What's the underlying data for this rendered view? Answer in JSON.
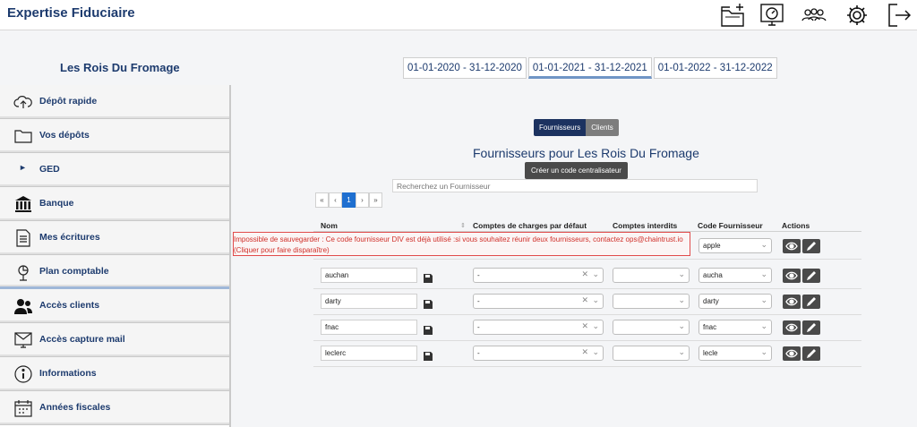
{
  "app": {
    "title": "Expertise Fiduciaire"
  },
  "topbar": {
    "icons": [
      "folder-plus-icon",
      "dashboard-icon",
      "users-icon",
      "gear-icon",
      "logout-icon"
    ]
  },
  "client": {
    "name": "Les Rois Du Fromage"
  },
  "years": [
    {
      "label": "01-01-2020 - 31-12-2020"
    },
    {
      "label": "01-01-2021 - 31-12-2021",
      "active": true
    },
    {
      "label": "01-01-2022 - 31-12-2022"
    }
  ],
  "sidebar": {
    "items": [
      {
        "label": "Dépôt rapide",
        "icon": "cloud-upload-icon"
      },
      {
        "label": "Vos dépôts",
        "icon": "folder-icon"
      },
      {
        "label": "GED",
        "icon": "caret-right-icon"
      },
      {
        "label": "Banque",
        "icon": "bank-icon"
      },
      {
        "label": "Mes écritures",
        "icon": "document-icon"
      },
      {
        "label": "Plan comptable",
        "icon": "chart-tree-icon"
      },
      {
        "label": "Accès clients",
        "icon": "users-icon"
      },
      {
        "label": "Accès capture mail",
        "icon": "mail-capture-icon"
      },
      {
        "label": "Informations",
        "icon": "info-icon"
      },
      {
        "label": "Années fiscales",
        "icon": "calendar-icon"
      }
    ]
  },
  "main": {
    "toggle": {
      "on": "Fournisseurs",
      "off": "Clients"
    },
    "title": "Fournisseurs pour Les Rois Du Fromage",
    "create_button": "Créer un code centralisateur",
    "search": {
      "placeholder": "Recherchez un Fournisseur",
      "value": ""
    },
    "pager": [
      "«",
      "‹",
      "1",
      "›",
      "»"
    ],
    "columns": {
      "name": "Nom",
      "charges": "Comptes de charges par défaut",
      "forbidden": "Comptes interdits",
      "code": "Code Fournisseur",
      "actions": "Actions"
    },
    "error": {
      "line1": "Impossible de sauvegarder : Ce code fournisseur DIV est déjà utilisé :si vous souhaitez réunir deux fournisseurs, contactez ops@chaintrust.io",
      "line2": "(Cliquer pour faire disparaître)"
    },
    "rows": [
      {
        "name": "",
        "charges": "",
        "code": "apple"
      },
      {
        "name": "auchan",
        "charges": "-",
        "code": "aucha"
      },
      {
        "name": "darty",
        "charges": "-",
        "code": "darty"
      },
      {
        "name": "fnac",
        "charges": "-",
        "code": "fnac"
      },
      {
        "name": "leclerc",
        "charges": "-",
        "code": "lecle"
      }
    ]
  },
  "colors": {
    "accent": "#1d3b6e",
    "active_tab": "#1c3260",
    "error": "#d0302a",
    "page_link": "#1e6fd0"
  }
}
